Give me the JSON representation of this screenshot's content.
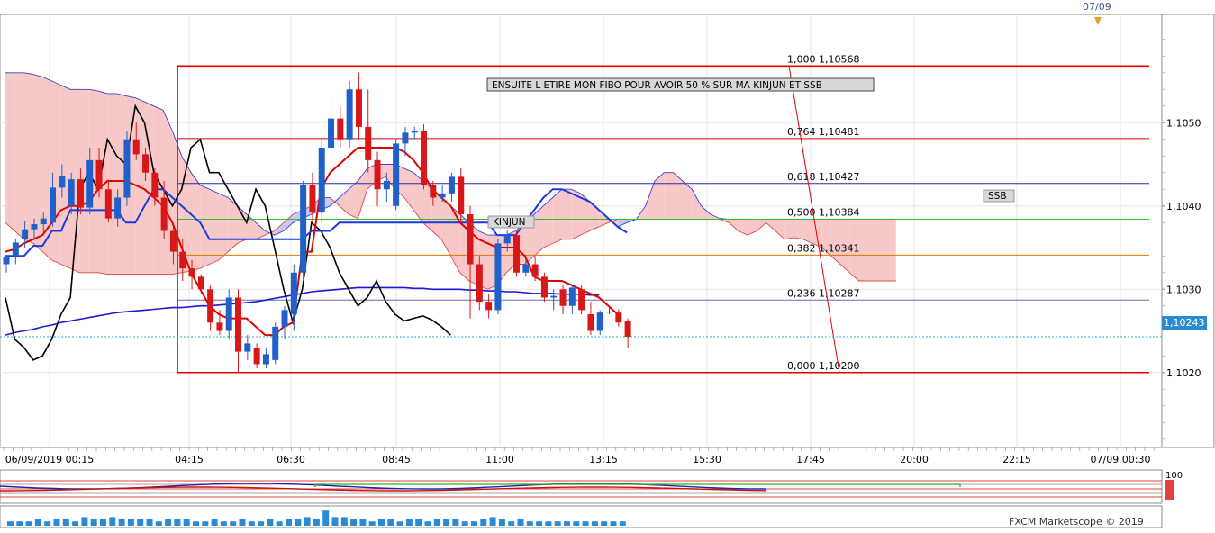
{
  "header": {
    "date_marker": "07/09"
  },
  "price_axis": {
    "ticks": [
      "1,1050",
      "1,1040",
      "1,1030",
      "1,1020"
    ],
    "current_price": "1,10243"
  },
  "time_axis": {
    "ticks": [
      "06/09/2019 00:15",
      "04:15",
      "06:30",
      "08:45",
      "11:00",
      "13:15",
      "15:30",
      "17:45",
      "20:00",
      "22:15",
      "07/09 00:30"
    ]
  },
  "annotations": {
    "main_note": "ENSUITE L ETIRE MON FIBO POUR AVOIR 50 %  SUR MA KINJUN ET SSB",
    "kinjun": "KINJUN",
    "ssb": "SSB"
  },
  "fibonacci": [
    {
      "label": "1,000 1,10568",
      "price": 1.10568,
      "color": "#e00000"
    },
    {
      "label": "0,764 1,10481",
      "price": 1.10481,
      "color": "#cc0000"
    },
    {
      "label": "0,618 1,10427",
      "price": 1.10427,
      "color": "#2a2aa8"
    },
    {
      "label": "0,500 1,10384",
      "price": 1.10384,
      "color": "#33bb33"
    },
    {
      "label": "0,382 1,10341",
      "price": 1.10341,
      "color": "#dd7700"
    },
    {
      "label": "0,236 1,10287",
      "price": 1.10287,
      "color": "#6a6aaa"
    },
    {
      "label": "0,000 1,10200",
      "price": 1.102,
      "color": "#e00000"
    }
  ],
  "oscillator": {
    "top_value": "100"
  },
  "footer": {
    "brand": "FXCM Marketscope © 2019"
  },
  "chart_data": {
    "type": "candlestick",
    "title": "",
    "ylim": [
      1.1011,
      1.1063
    ],
    "grid": true,
    "current_price": 1.10243,
    "candles": [
      {
        "o": 1.1033,
        "h": 1.1034,
        "l": 1.1032,
        "c": 1.10338
      },
      {
        "o": 1.1034,
        "h": 1.1036,
        "l": 1.1033,
        "c": 1.10356
      },
      {
        "o": 1.1036,
        "h": 1.10382,
        "l": 1.1035,
        "c": 1.10372
      },
      {
        "o": 1.10372,
        "h": 1.10385,
        "l": 1.1036,
        "c": 1.10378
      },
      {
        "o": 1.10378,
        "h": 1.10392,
        "l": 1.10368,
        "c": 1.10385
      },
      {
        "o": 1.1038,
        "h": 1.1044,
        "l": 1.10375,
        "c": 1.10422
      },
      {
        "o": 1.10422,
        "h": 1.1045,
        "l": 1.1041,
        "c": 1.10436
      },
      {
        "o": 1.104,
        "h": 1.1044,
        "l": 1.1039,
        "c": 1.10432
      },
      {
        "o": 1.10432,
        "h": 1.10445,
        "l": 1.1039,
        "c": 1.10398
      },
      {
        "o": 1.10398,
        "h": 1.1047,
        "l": 1.1039,
        "c": 1.10455
      },
      {
        "o": 1.10455,
        "h": 1.1047,
        "l": 1.1041,
        "c": 1.1042
      },
      {
        "o": 1.1042,
        "h": 1.1043,
        "l": 1.1038,
        "c": 1.10385
      },
      {
        "o": 1.10385,
        "h": 1.1042,
        "l": 1.10375,
        "c": 1.1041
      },
      {
        "o": 1.1041,
        "h": 1.1049,
        "l": 1.104,
        "c": 1.1048
      },
      {
        "o": 1.1048,
        "h": 1.105,
        "l": 1.10455,
        "c": 1.10462
      },
      {
        "o": 1.10462,
        "h": 1.1047,
        "l": 1.1043,
        "c": 1.1044
      },
      {
        "o": 1.1044,
        "h": 1.10445,
        "l": 1.104,
        "c": 1.1041
      },
      {
        "o": 1.1041,
        "h": 1.1043,
        "l": 1.1036,
        "c": 1.1037
      },
      {
        "o": 1.1037,
        "h": 1.10375,
        "l": 1.1033,
        "c": 1.10345
      },
      {
        "o": 1.10345,
        "h": 1.1036,
        "l": 1.1031,
        "c": 1.10325
      },
      {
        "o": 1.10325,
        "h": 1.10335,
        "l": 1.103,
        "c": 1.10315
      },
      {
        "o": 1.10315,
        "h": 1.10318,
        "l": 1.10295,
        "c": 1.103
      },
      {
        "o": 1.103,
        "h": 1.10305,
        "l": 1.1025,
        "c": 1.1026
      },
      {
        "o": 1.1026,
        "h": 1.10275,
        "l": 1.10245,
        "c": 1.1025
      },
      {
        "o": 1.1025,
        "h": 1.103,
        "l": 1.1024,
        "c": 1.1029
      },
      {
        "o": 1.1029,
        "h": 1.103,
        "l": 1.102,
        "c": 1.10225
      },
      {
        "o": 1.10225,
        "h": 1.10245,
        "l": 1.10215,
        "c": 1.10235
      },
      {
        "o": 1.1023,
        "h": 1.10235,
        "l": 1.10205,
        "c": 1.1021
      },
      {
        "o": 1.1021,
        "h": 1.1023,
        "l": 1.10205,
        "c": 1.10222
      },
      {
        "o": 1.10215,
        "h": 1.1026,
        "l": 1.1021,
        "c": 1.10255
      },
      {
        "o": 1.10255,
        "h": 1.1028,
        "l": 1.1024,
        "c": 1.10275
      },
      {
        "o": 1.1027,
        "h": 1.1033,
        "l": 1.1025,
        "c": 1.1032
      },
      {
        "o": 1.1032,
        "h": 1.1043,
        "l": 1.1031,
        "c": 1.10425
      },
      {
        "o": 1.10425,
        "h": 1.1044,
        "l": 1.1038,
        "c": 1.10392
      },
      {
        "o": 1.10392,
        "h": 1.1048,
        "l": 1.1038,
        "c": 1.1047
      },
      {
        "o": 1.1047,
        "h": 1.1053,
        "l": 1.1044,
        "c": 1.10505
      },
      {
        "o": 1.10505,
        "h": 1.1052,
        "l": 1.1047,
        "c": 1.1048
      },
      {
        "o": 1.1048,
        "h": 1.1055,
        "l": 1.1047,
        "c": 1.1054
      },
      {
        "o": 1.1054,
        "h": 1.1056,
        "l": 1.1048,
        "c": 1.10495
      },
      {
        "o": 1.10495,
        "h": 1.1054,
        "l": 1.1044,
        "c": 1.10455
      },
      {
        "o": 1.10455,
        "h": 1.10465,
        "l": 1.104,
        "c": 1.1042
      },
      {
        "o": 1.1042,
        "h": 1.1044,
        "l": 1.10405,
        "c": 1.1043
      },
      {
        "o": 1.104,
        "h": 1.1048,
        "l": 1.10395,
        "c": 1.10475
      },
      {
        "o": 1.10475,
        "h": 1.10495,
        "l": 1.1046,
        "c": 1.10488
      },
      {
        "o": 1.10488,
        "h": 1.10495,
        "l": 1.1048,
        "c": 1.1049
      },
      {
        "o": 1.1049,
        "h": 1.10498,
        "l": 1.1042,
        "c": 1.10425
      },
      {
        "o": 1.10425,
        "h": 1.1043,
        "l": 1.104,
        "c": 1.1041
      },
      {
        "o": 1.1041,
        "h": 1.10425,
        "l": 1.10405,
        "c": 1.10415
      },
      {
        "o": 1.10415,
        "h": 1.1044,
        "l": 1.10405,
        "c": 1.10435
      },
      {
        "o": 1.10435,
        "h": 1.10445,
        "l": 1.1038,
        "c": 1.1039
      },
      {
        "o": 1.1039,
        "h": 1.104,
        "l": 1.10265,
        "c": 1.1033
      },
      {
        "o": 1.1033,
        "h": 1.1034,
        "l": 1.10275,
        "c": 1.10285
      },
      {
        "o": 1.10285,
        "h": 1.10295,
        "l": 1.10265,
        "c": 1.10275
      },
      {
        "o": 1.10275,
        "h": 1.1036,
        "l": 1.1027,
        "c": 1.10355
      },
      {
        "o": 1.10355,
        "h": 1.1037,
        "l": 1.10345,
        "c": 1.10365
      },
      {
        "o": 1.10365,
        "h": 1.1037,
        "l": 1.10315,
        "c": 1.1032
      },
      {
        "o": 1.1032,
        "h": 1.10335,
        "l": 1.10315,
        "c": 1.1033
      },
      {
        "o": 1.1033,
        "h": 1.1034,
        "l": 1.1031,
        "c": 1.10315
      },
      {
        "o": 1.10315,
        "h": 1.1032,
        "l": 1.10285,
        "c": 1.1029
      },
      {
        "o": 1.1029,
        "h": 1.103,
        "l": 1.10275,
        "c": 1.10292
      },
      {
        "o": 1.103,
        "h": 1.10305,
        "l": 1.1027,
        "c": 1.1028
      },
      {
        "o": 1.1028,
        "h": 1.10305,
        "l": 1.1027,
        "c": 1.10302
      },
      {
        "o": 1.103,
        "h": 1.10305,
        "l": 1.1027,
        "c": 1.10275
      },
      {
        "o": 1.1027,
        "h": 1.10285,
        "l": 1.10245,
        "c": 1.1025
      },
      {
        "o": 1.1025,
        "h": 1.10275,
        "l": 1.10245,
        "c": 1.10272
      },
      {
        "o": 1.10272,
        "h": 1.1028,
        "l": 1.1027,
        "c": 1.10273
      },
      {
        "o": 1.10272,
        "h": 1.10276,
        "l": 1.10255,
        "c": 1.1026
      },
      {
        "o": 1.10262,
        "h": 1.10265,
        "l": 1.1023,
        "c": 1.10243
      }
    ],
    "kijun": [
      1.1034,
      1.1034,
      1.1034,
      1.10352,
      1.10352,
      1.1037,
      1.1037,
      1.10395,
      1.10395,
      1.10395,
      1.10395,
      1.10395,
      1.10395,
      1.1038,
      1.1038,
      1.104,
      1.1042,
      1.1042,
      1.1041,
      1.104,
      1.1039,
      1.1038,
      1.1036,
      1.1036,
      1.1036,
      1.1036,
      1.1036,
      1.1036,
      1.1036,
      1.1036,
      1.1036,
      1.1036,
      1.1036,
      1.1037,
      1.1037,
      1.1037,
      1.1038,
      1.1038,
      1.1038,
      1.1038,
      1.1038,
      1.1038,
      1.1038,
      1.1038,
      1.1038,
      1.1038,
      1.1038,
      1.1038,
      1.1038,
      1.1038,
      1.1038,
      1.1038,
      1.1038,
      1.10365,
      1.10365,
      1.10365,
      1.1038,
      1.10395,
      1.1041,
      1.1042,
      1.1042,
      1.10415,
      1.1041,
      1.10405,
      1.10395,
      1.10385,
      1.10375,
      1.10368
    ],
    "tenkan": [
      1.10345,
      1.10348,
      1.10355,
      1.1036,
      1.10365,
      1.1038,
      1.10395,
      1.104,
      1.104,
      1.10405,
      1.1042,
      1.1043,
      1.1043,
      1.1043,
      1.10425,
      1.1042,
      1.1041,
      1.104,
      1.1038,
      1.1035,
      1.1032,
      1.103,
      1.1028,
      1.1027,
      1.10265,
      1.10265,
      1.10265,
      1.10255,
      1.10245,
      1.10245,
      1.10255,
      1.1026,
      1.10345,
      1.10345,
      1.1042,
      1.1044,
      1.1045,
      1.1046,
      1.1047,
      1.1047,
      1.1047,
      1.1047,
      1.1047,
      1.10465,
      1.10455,
      1.1044,
      1.1042,
      1.1041,
      1.104,
      1.1038,
      1.1037,
      1.1036,
      1.10355,
      1.1035,
      1.1035,
      1.1035,
      1.1034,
      1.10315,
      1.1031,
      1.1031,
      1.1031,
      1.10305,
      1.103,
      1.10295,
      1.1029,
      1.1028,
      1.1027
    ],
    "chikou": [
      1.1029,
      1.1024,
      1.1023,
      1.10215,
      1.1022,
      1.1024,
      1.1027,
      1.1029,
      1.1042,
      1.1044,
      1.1042,
      1.1048,
      1.1046,
      1.1045,
      1.1052,
      1.105,
      1.1044,
      1.1042,
      1.104,
      1.1042,
      1.1047,
      1.1048,
      1.1044,
      1.1044,
      1.1042,
      1.104,
      1.1038,
      1.1042,
      1.104,
      1.1035,
      1.103,
      1.1026,
      1.103,
      1.1038,
      1.1037,
      1.1035,
      1.1032,
      1.103,
      1.1028,
      1.1029,
      1.1031,
      1.10285,
      1.1027,
      1.10262,
      1.10265,
      1.10268,
      1.10263,
      1.10255,
      1.10245
    ],
    "sma": [
      1.10245,
      1.10248,
      1.1025,
      1.10252,
      1.10255,
      1.10257,
      1.1026,
      1.10262,
      1.10264,
      1.10266,
      1.10268,
      1.1027,
      1.10272,
      1.10273,
      1.10274,
      1.10275,
      1.10276,
      1.10277,
      1.10278,
      1.10278,
      1.10279,
      1.1028,
      1.1028,
      1.10281,
      1.10282,
      1.10283,
      1.10284,
      1.10285,
      1.10287,
      1.10289,
      1.10291,
      1.10293,
      1.10295,
      1.10297,
      1.10298,
      1.10299,
      1.103,
      1.10301,
      1.10302,
      1.10302,
      1.10302,
      1.10302,
      1.10302,
      1.10302,
      1.10301,
      1.10301,
      1.103,
      1.103,
      1.103,
      1.103,
      1.10299,
      1.10299,
      1.10298,
      1.10298,
      1.10297,
      1.10297,
      1.10296,
      1.10295,
      1.10295,
      1.10295,
      1.10294,
      1.10294,
      1.10294,
      1.10293,
      1.10293
    ],
    "cloud_upper": [
      1.1056,
      1.1056,
      1.1056,
      1.10558,
      1.10555,
      1.1055,
      1.10545,
      1.1054,
      1.1054,
      1.1054,
      1.10538,
      1.10535,
      1.10535,
      1.10532,
      1.1053,
      1.10525,
      1.1052,
      1.10515,
      1.1049,
      1.1046,
      1.1044,
      1.10425,
      1.1042,
      1.10415,
      1.1041,
      1.104,
      1.1039,
      1.1038,
      1.1037,
      1.10365,
      1.1037,
      1.1038,
      1.10385,
      1.1039,
      1.10395,
      1.104,
      1.1041,
      1.1042,
      1.1043,
      1.10445,
      1.1045,
      1.1045,
      1.1045,
      1.10445,
      1.1044,
      1.1043,
      1.1042,
      1.1041,
      1.104,
      1.1039,
      1.1038,
      1.1037,
      1.10365,
      1.10365,
      1.10365,
      1.1037,
      1.1038,
      1.1039,
      1.104,
      1.1041,
      1.1042,
      1.1042,
      1.10415,
      1.10405,
      1.10395,
      1.10385,
      1.10375,
      1.1038,
      1.10384,
      1.104,
      1.1043,
      1.1044,
      1.1044,
      1.1043,
      1.1042,
      1.104,
      1.1039,
      1.10385,
      1.10384,
      1.10384,
      1.10384,
      1.10384,
      1.10384,
      1.10384,
      1.10384,
      1.10384,
      1.10384,
      1.10384,
      1.10384,
      1.10384,
      1.10384,
      1.10384,
      1.10384,
      1.10384,
      1.10384,
      1.10384,
      1.10384
    ],
    "cloud_lower": [
      1.1038,
      1.1037,
      1.1036,
      1.10355,
      1.10345,
      1.10335,
      1.1033,
      1.10325,
      1.1032,
      1.1032,
      1.1032,
      1.10318,
      1.10318,
      1.10318,
      1.10318,
      1.10318,
      1.10318,
      1.10318,
      1.10318,
      1.1032,
      1.10322,
      1.10325,
      1.1033,
      1.10335,
      1.10345,
      1.10355,
      1.1036,
      1.1036,
      1.10365,
      1.1037,
      1.1038,
      1.1039,
      1.10395,
      1.104,
      1.1041,
      1.1041,
      1.104,
      1.1039,
      1.10385,
      1.1042,
      1.1043,
      1.10435,
      1.1042,
      1.1041,
      1.10395,
      1.1038,
      1.1037,
      1.1036,
      1.1034,
      1.1032,
      1.1031,
      1.10305,
      1.103,
      1.10305,
      1.1032,
      1.1033,
      1.1033,
      1.1034,
      1.1035,
      1.10355,
      1.1036,
      1.1036,
      1.10365,
      1.1037,
      1.10375,
      1.1038,
      1.10384,
      1.10384,
      1.10384,
      1.10384,
      1.10384,
      1.10384,
      1.10384,
      1.10384,
      1.10384,
      1.10384,
      1.10384,
      1.10384,
      1.1038,
      1.1037,
      1.10365,
      1.1037,
      1.1038,
      1.1037,
      1.1036,
      1.10362,
      1.1036,
      1.10355,
      1.1035,
      1.1034,
      1.1033,
      1.1032,
      1.1031,
      1.1031,
      1.1031,
      1.1031,
      1.1031
    ],
    "volume": [
      2,
      2,
      2,
      3,
      2,
      3,
      3,
      2,
      4,
      3,
      3,
      4,
      3,
      3,
      3,
      3,
      2,
      3,
      3,
      3,
      2,
      2,
      3,
      2,
      2,
      3,
      2,
      2,
      3,
      2,
      3,
      3,
      4,
      3,
      7,
      4,
      4,
      3,
      3,
      2,
      3,
      3,
      2,
      3,
      3,
      2,
      3,
      3,
      3,
      2,
      2,
      3,
      4,
      3,
      2,
      3,
      2,
      2,
      2,
      2,
      2,
      2,
      2,
      2,
      2,
      2,
      2
    ]
  }
}
